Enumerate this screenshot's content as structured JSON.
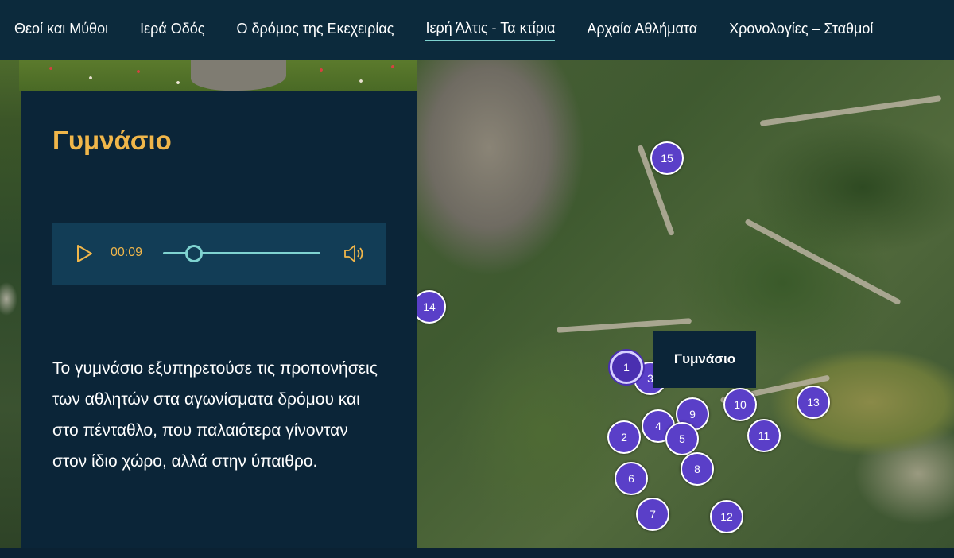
{
  "nav": {
    "items": [
      {
        "label": "Θεοί και Μύθοι",
        "active": false
      },
      {
        "label": "Ιερά Οδός",
        "active": false
      },
      {
        "label": "Ο δρόμος της Εκεχειρίας",
        "active": false
      },
      {
        "label": "Ιερή Άλτις - Τα κτίρια",
        "active": true
      },
      {
        "label": "Αρχαία Αθλήματα",
        "active": false
      },
      {
        "label": "Χρονολογίες – Σταθμοί",
        "active": false
      }
    ]
  },
  "panel": {
    "title": "Γυμνάσιο",
    "audio": {
      "time": "00:09",
      "progress_percent": 20,
      "play_icon": "play-icon",
      "volume_icon": "volume-icon"
    },
    "description": "Το γυμνάσιο εξυπηρετούσε τις προπονήσεις των αθλητών στα αγωνίσματα δρόμου και στο πένταθλο, που παλαιότερα γίνονταν στον ίδιο χώρο, αλλά στην ύπαιθρο."
  },
  "map": {
    "tooltip": "Γυμνάσιο",
    "selected_marker": "1",
    "markers": [
      "1",
      "2",
      "3",
      "4",
      "5",
      "6",
      "7",
      "8",
      "9",
      "10",
      "11",
      "12",
      "13",
      "14",
      "15"
    ]
  },
  "colors": {
    "nav_bg": "#0c2a3c",
    "panel_bg": "#0b2538",
    "accent_gold": "#f0b64a",
    "accent_teal": "#7fd3d0",
    "marker_purple": "#5a3fc8"
  }
}
